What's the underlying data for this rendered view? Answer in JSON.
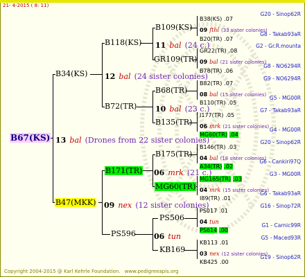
{
  "date": "21- 4-2015 ( 8: 11)",
  "copyright": "Copyright 2004-2015 @ Karl Kehrle Foundation.",
  "website": "www.pedigreeapis.org",
  "root": {
    "label": "B67(KS)"
  },
  "gen1": {
    "count": "13",
    "letter": "bal",
    "text": "(Drones from 22 sister colonies)"
  },
  "father": {
    "label": "B34(KS)"
  },
  "mother": {
    "label": "B47(MKK)",
    "count": "09",
    "letter": "nex",
    "text": "(12 sister colonies)"
  },
  "ff": {
    "label": "B118(KS)",
    "count": "12",
    "letter": "bal",
    "text": "(24 sister colonies)"
  },
  "fm": {
    "label": "B72(TR)",
    "count": "10",
    "letter": "bal",
    "text": "(23 c.)"
  },
  "mf": {
    "label": "B171(TR)",
    "count": "06",
    "letter": "mrk",
    "text": "(21 c.)"
  },
  "mm": {
    "label": "PS596",
    "count": "06",
    "letter": "tun",
    "text": ""
  },
  "fff": {
    "label": "B109(KS)",
    "count": "11",
    "letter": "bal",
    "text": "(24 c.)"
  },
  "ffm": {
    "label": "GR109(TR)"
  },
  "fmf": {
    "label": "B68(TR)"
  },
  "fmm": {
    "label": "B135(TR)"
  },
  "mff": {
    "label": "B175(TR)"
  },
  "mfm": {
    "label": "MG60(TR)"
  },
  "mmf": {
    "label": "PS506"
  },
  "mmm": {
    "label": "KB169"
  },
  "leaves": [
    {
      "name": "B38(KS)",
      "val": ".07",
      "cls": "G20 - Sinop62R",
      "hl": ""
    },
    {
      "count": "09",
      "letter": "fthl",
      "text": "(33 sister colonies)"
    },
    {
      "name": "B20(TR)",
      "val": ".07",
      "cls": "G8 - Takab93aR",
      "hl": ""
    },
    {
      "name": "GR22(TR)",
      "val": ".08",
      "cls": "G2 - Gr.R.mounta",
      "hl": ""
    },
    {
      "count": "09",
      "letter": "bal",
      "text": "(21 sister colonies)"
    },
    {
      "name": "B78(TR)",
      "val": ".06",
      "cls": "G8 - NO6294R",
      "hl": ""
    },
    {
      "name": "B82(TR)",
      "val": ".07",
      "cls": "G9 - NO6294R",
      "hl": ""
    },
    {
      "count": "08",
      "letter": "bal",
      "text": "(15 sister colonies)"
    },
    {
      "name": "B110(TR)",
      "val": ".05",
      "cls": "G5 - MG00R",
      "hl": ""
    },
    {
      "name": "I177(TR)",
      "val": ".05",
      "cls": "G7 - Takab93aR",
      "hl": ""
    },
    {
      "count": "06",
      "letter": "mrk",
      "text": "(21 sister colonies)"
    },
    {
      "name": "MG60(TR)",
      "val": ".04",
      "cls": "G4 - MG00R",
      "hl": "green"
    },
    {
      "name": "B146(TR)",
      "val": ".03",
      "cls": "G20 - Sinop62R",
      "hl": ""
    },
    {
      "count": "04",
      "letter": "bal",
      "text": "(18 sister colonies)"
    },
    {
      "name": "A34(TR)",
      "val": ".02",
      "cls": "G6 - Cankiri97Q",
      "hl": "green"
    },
    {
      "name": "MG165(TR)",
      "val": ".03",
      "cls": "G3 - MG00R",
      "hl": "green"
    },
    {
      "count": "04",
      "letter": "mrk",
      "text": "(15 sister colonies)"
    },
    {
      "name": "I89(TR)",
      "val": ".01",
      "cls": "G6 - Takab93aR",
      "hl": ""
    },
    {
      "name": "PS017",
      "val": ".01",
      "cls": "G16 - Sinop72R",
      "hl": ""
    },
    {
      "count": "04",
      "letter": "tun",
      "text": ""
    },
    {
      "name": "PS614",
      "val": ".00",
      "cls": "G1 - Carnic99R",
      "hl": "green"
    },
    {
      "name": "KB113",
      "val": ".01",
      "cls": "G5 - Maced93R",
      "hl": ""
    },
    {
      "count": "03",
      "letter": "nex",
      "text": "(12 sister colonies)"
    },
    {
      "name": "KB425",
      "val": ".00",
      "cls": "G19 - Sinop62R",
      "hl": ""
    }
  ]
}
